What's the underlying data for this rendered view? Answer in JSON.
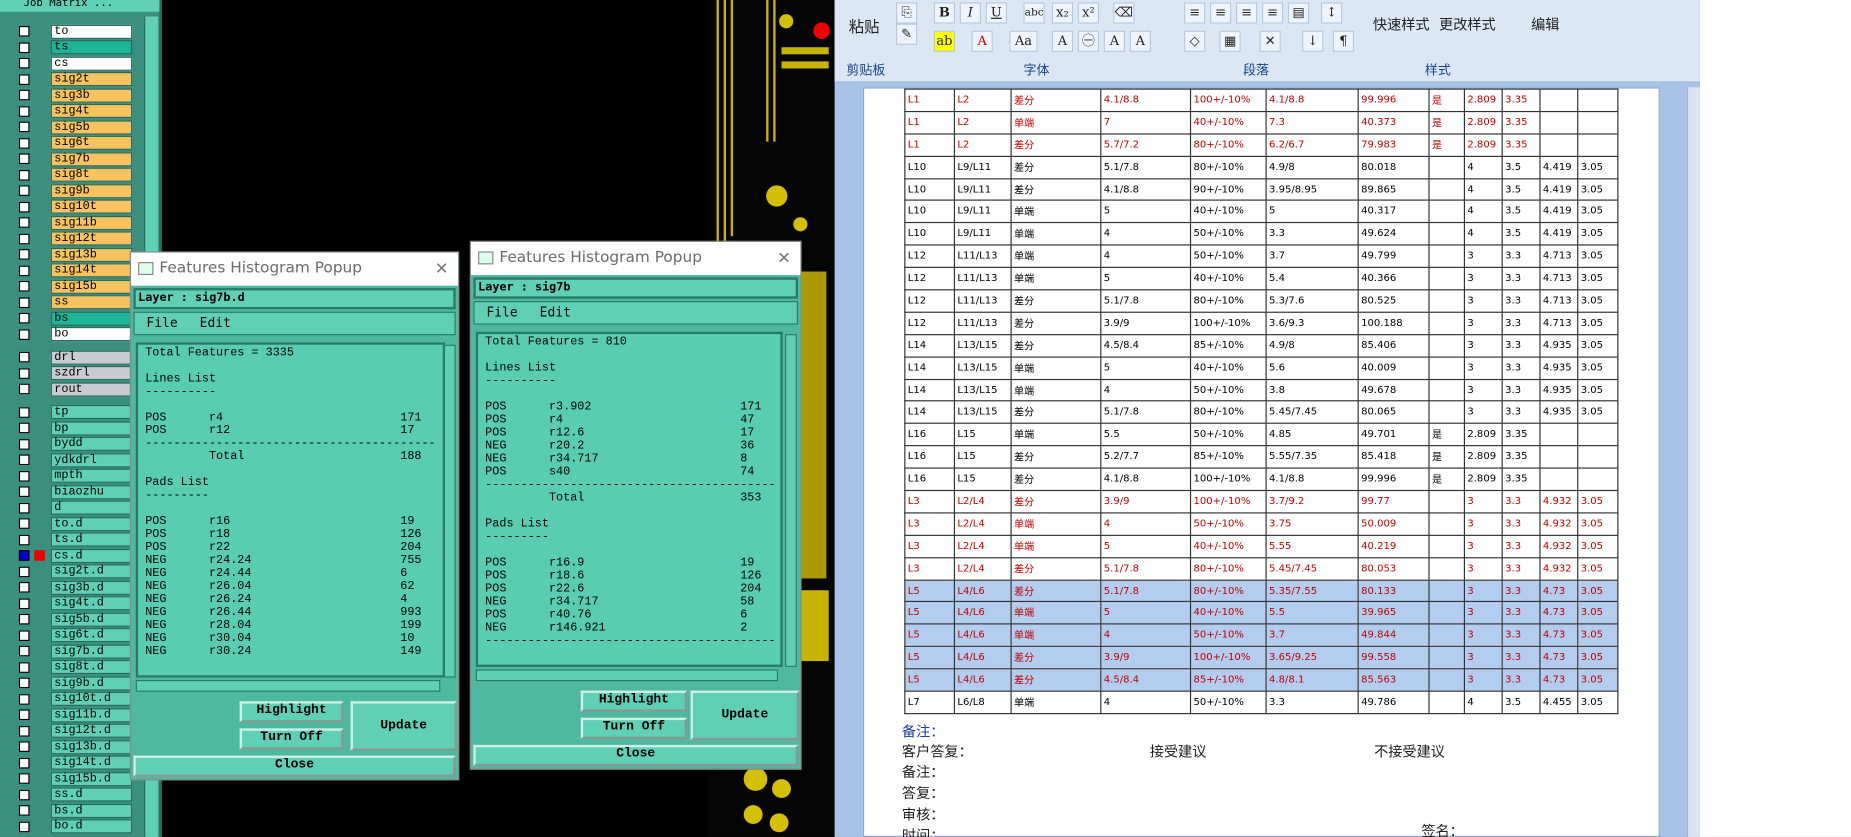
{
  "layer_panel": {
    "title": "Job Matrix ...",
    "rows": [
      {
        "name": "to",
        "style": "wht"
      },
      {
        "name": "ts",
        "style": "teal"
      },
      {
        "name": "cs",
        "style": "wht"
      },
      {
        "name": "sig2t",
        "style": "yel"
      },
      {
        "name": "sig3b",
        "style": "yel"
      },
      {
        "name": "sig4t",
        "style": "yel"
      },
      {
        "name": "sig5b",
        "style": "yel"
      },
      {
        "name": "sig6t",
        "style": "yel"
      },
      {
        "name": "sig7b",
        "style": "yel"
      },
      {
        "name": "sig8t",
        "style": "yel"
      },
      {
        "name": "sig9b",
        "style": "yel"
      },
      {
        "name": "sig10t",
        "style": "yel"
      },
      {
        "name": "sig11b",
        "style": "yel"
      },
      {
        "name": "sig12t",
        "style": "yel"
      },
      {
        "name": "sig13b",
        "style": "yel"
      },
      {
        "name": "sig14t",
        "style": "yel"
      },
      {
        "name": "sig15b",
        "style": "yel"
      },
      {
        "name": "ss",
        "style": "yel"
      },
      {
        "name": "bs",
        "style": "teal"
      },
      {
        "name": "bo",
        "style": "wht"
      },
      {
        "name": "drl",
        "style": "gry"
      },
      {
        "name": "szdrl",
        "style": "gry"
      },
      {
        "name": "rout",
        "style": "gry"
      },
      {
        "name": "tp",
        "style": ""
      },
      {
        "name": "bp",
        "style": ""
      },
      {
        "name": "bydd",
        "style": ""
      },
      {
        "name": "ydkdrl",
        "style": ""
      },
      {
        "name": "mpth",
        "style": ""
      },
      {
        "name": "biaozhu",
        "style": ""
      },
      {
        "name": "d",
        "style": ""
      },
      {
        "name": "to.d",
        "style": ""
      },
      {
        "name": "ts.d",
        "style": ""
      },
      {
        "name": "cs.d",
        "style": "",
        "active": true
      },
      {
        "name": "sig2t.d",
        "style": ""
      },
      {
        "name": "sig3b.d",
        "style": ""
      },
      {
        "name": "sig4t.d",
        "style": ""
      },
      {
        "name": "sig5b.d",
        "style": ""
      },
      {
        "name": "sig6t.d",
        "style": ""
      },
      {
        "name": "sig7b.d",
        "style": ""
      },
      {
        "name": "sig8t.d",
        "style": ""
      },
      {
        "name": "sig9b.d",
        "style": ""
      },
      {
        "name": "sig10t.d",
        "style": ""
      },
      {
        "name": "sig11b.d",
        "style": ""
      },
      {
        "name": "sig12t.d",
        "style": ""
      },
      {
        "name": "sig13b.d",
        "style": ""
      },
      {
        "name": "sig14t.d",
        "style": ""
      },
      {
        "name": "sig15b.d",
        "style": ""
      },
      {
        "name": "ss.d",
        "style": ""
      },
      {
        "name": "bs.d",
        "style": ""
      },
      {
        "name": "bo.d",
        "style": ""
      }
    ]
  },
  "popup1": {
    "title": "Features Histogram Popup",
    "layer": "Layer :  sig7b.d",
    "menu": [
      "File",
      "Edit"
    ],
    "text": "Total Features = 3335\n\nLines List\n----------\n\nPOS      r4                         171\nPOS      r12                        17\n-----------------------------------------\n         Total                      188\n\nPads List\n---------\n\nPOS      r16                        19\nPOS      r18                        126\nPOS      r22                        204\nNEG      r24.24                     755\nNEG      r24.44                     6\nNEG      r26.04                     62\nNEG      r26.24                     4\nNEG      r26.44                     993\nNEG      r28.04                     199\nNEG      r30.04                     10\nNEG      r30.24                     149",
    "buttons": {
      "highlight": "Highlight",
      "turnoff": "Turn Off",
      "update": "Update",
      "close": "Close"
    }
  },
  "popup2": {
    "title": "Features Histogram Popup",
    "layer": "Layer :  sig7b",
    "menu": [
      "File",
      "Edit"
    ],
    "text": "Total Features = 810\n\nLines List\n----------\n\nPOS      r3.902                     171\nPOS      r4                         47\nPOS      r12.6                      17\nNEG      r20.2                      36\nNEG      r34.717                    8\nPOS      s40                        74\n-----------------------------------------\n         Total                      353\n\nPads List\n---------\n\nPOS      r16.9                      19\nPOS      r18.6                      126\nPOS      r22.6                      204\nNEG      r34.717                    58\nPOS      r40.76                     6\nNEG      r146.921                   2\n-----------------------------------------",
    "buttons": {
      "highlight": "Highlight",
      "turnoff": "Turn Off",
      "update": "Update",
      "close": "Close"
    }
  },
  "ribbon": {
    "paste": "粘贴",
    "clipboard": "剪贴板",
    "font": "字体",
    "paragraph": "段落",
    "styles": "样式",
    "quick_styles": "快速样式",
    "change_styles": "更改样式",
    "edit": "编辑",
    "font_buttons": [
      "B",
      "I",
      "U",
      "abc",
      "x₂",
      "x²",
      "A",
      "Aa",
      "A",
      "A",
      "A"
    ]
  },
  "table_rows": [
    {
      "cls": "red",
      "c": [
        "L1",
        "L2",
        "差分",
        "4.1/8.8",
        "100+/-10%",
        "4.1/8.8",
        "99.996",
        "是",
        "2.809",
        "3.35",
        "",
        ""
      ]
    },
    {
      "cls": "red",
      "c": [
        "L1",
        "L2",
        "单端",
        "7",
        "40+/-10%",
        "7.3",
        "40.373",
        "是",
        "2.809",
        "3.35",
        "",
        ""
      ]
    },
    {
      "cls": "red",
      "c": [
        "L1",
        "L2",
        "差分",
        "5.7/7.2",
        "80+/-10%",
        "6.2/6.7",
        "79.983",
        "是",
        "2.809",
        "3.35",
        "",
        ""
      ]
    },
    {
      "cls": "",
      "c": [
        "L10",
        "L9/L11",
        "差分",
        "5.1/7.8",
        "80+/-10%",
        "4.9/8",
        "80.018",
        "",
        "4",
        "3.5",
        "4.419",
        "3.05"
      ]
    },
    {
      "cls": "",
      "c": [
        "L10",
        "L9/L11",
        "差分",
        "4.1/8.8",
        "90+/-10%",
        "3.95/8.95",
        "89.865",
        "",
        "4",
        "3.5",
        "4.419",
        "3.05"
      ]
    },
    {
      "cls": "",
      "c": [
        "L10",
        "L9/L11",
        "单端",
        "5",
        "40+/-10%",
        "5",
        "40.317",
        "",
        "4",
        "3.5",
        "4.419",
        "3.05"
      ]
    },
    {
      "cls": "",
      "c": [
        "L10",
        "L9/L11",
        "单端",
        "4",
        "50+/-10%",
        "3.3",
        "49.624",
        "",
        "4",
        "3.5",
        "4.419",
        "3.05"
      ]
    },
    {
      "cls": "",
      "c": [
        "L12",
        "L11/L13",
        "单端",
        "4",
        "50+/-10%",
        "3.7",
        "49.799",
        "",
        "3",
        "3.3",
        "4.713",
        "3.05"
      ]
    },
    {
      "cls": "",
      "c": [
        "L12",
        "L11/L13",
        "单端",
        "5",
        "40+/-10%",
        "5.4",
        "40.366",
        "",
        "3",
        "3.3",
        "4.713",
        "3.05"
      ]
    },
    {
      "cls": "",
      "c": [
        "L12",
        "L11/L13",
        "差分",
        "5.1/7.8",
        "80+/-10%",
        "5.3/7.6",
        "80.525",
        "",
        "3",
        "3.3",
        "4.713",
        "3.05"
      ]
    },
    {
      "cls": "",
      "c": [
        "L12",
        "L11/L13",
        "差分",
        "3.9/9",
        "100+/-10%",
        "3.6/9.3",
        "100.188",
        "",
        "3",
        "3.3",
        "4.713",
        "3.05"
      ]
    },
    {
      "cls": "",
      "c": [
        "L14",
        "L13/L15",
        "差分",
        "4.5/8.4",
        "85+/-10%",
        "4.9/8",
        "85.406",
        "",
        "3",
        "3.3",
        "4.935",
        "3.05"
      ]
    },
    {
      "cls": "",
      "c": [
        "L14",
        "L13/L15",
        "单端",
        "5",
        "40+/-10%",
        "5.6",
        "40.009",
        "",
        "3",
        "3.3",
        "4.935",
        "3.05"
      ]
    },
    {
      "cls": "",
      "c": [
        "L14",
        "L13/L15",
        "单端",
        "4",
        "50+/-10%",
        "3.8",
        "49.678",
        "",
        "3",
        "3.3",
        "4.935",
        "3.05"
      ]
    },
    {
      "cls": "",
      "c": [
        "L14",
        "L13/L15",
        "差分",
        "5.1/7.8",
        "80+/-10%",
        "5.45/7.45",
        "80.065",
        "",
        "3",
        "3.3",
        "4.935",
        "3.05"
      ]
    },
    {
      "cls": "",
      "c": [
        "L16",
        "L15",
        "单端",
        "5.5",
        "50+/-10%",
        "4.85",
        "49.701",
        "是",
        "2.809",
        "3.35",
        "",
        ""
      ]
    },
    {
      "cls": "",
      "c": [
        "L16",
        "L15",
        "差分",
        "5.2/7.7",
        "85+/-10%",
        "5.55/7.35",
        "85.418",
        "是",
        "2.809",
        "3.35",
        "",
        ""
      ]
    },
    {
      "cls": "",
      "c": [
        "L16",
        "L15",
        "差分",
        "4.1/8.8",
        "100+/-10%",
        "4.1/8.8",
        "99.996",
        "是",
        "2.809",
        "3.35",
        "",
        ""
      ]
    },
    {
      "cls": "red",
      "c": [
        "L3",
        "L2/L4",
        "差分",
        "3.9/9",
        "100+/-10%",
        "3.7/9.2",
        "99.77",
        "",
        "3",
        "3.3",
        "4.932",
        "3.05"
      ]
    },
    {
      "cls": "red",
      "c": [
        "L3",
        "L2/L4",
        "单端",
        "4",
        "50+/-10%",
        "3.75",
        "50.009",
        "",
        "3",
        "3.3",
        "4.932",
        "3.05"
      ]
    },
    {
      "cls": "red",
      "c": [
        "L3",
        "L2/L4",
        "单端",
        "5",
        "40+/-10%",
        "5.55",
        "40.219",
        "",
        "3",
        "3.3",
        "4.932",
        "3.05"
      ]
    },
    {
      "cls": "red",
      "c": [
        "L3",
        "L2/L4",
        "差分",
        "5.1/7.8",
        "80+/-10%",
        "5.45/7.45",
        "80.053",
        "",
        "3",
        "3.3",
        "4.932",
        "3.05"
      ]
    },
    {
      "cls": "sel",
      "c": [
        "L5",
        "L4/L6",
        "差分",
        "5.1/7.8",
        "80+/-10%",
        "5.35/7.55",
        "80.133",
        "",
        "3",
        "3.3",
        "4.73",
        "3.05"
      ]
    },
    {
      "cls": "sel",
      "c": [
        "L5",
        "L4/L6",
        "单端",
        "5",
        "40+/-10%",
        "5.5",
        "39.965",
        "",
        "3",
        "3.3",
        "4.73",
        "3.05"
      ]
    },
    {
      "cls": "sel",
      "c": [
        "L5",
        "L4/L6",
        "单端",
        "4",
        "50+/-10%",
        "3.7",
        "49.844",
        "",
        "3",
        "3.3",
        "4.73",
        "3.05"
      ]
    },
    {
      "cls": "sel",
      "c": [
        "L5",
        "L4/L6",
        "差分",
        "3.9/9",
        "100+/-10%",
        "3.65/9.25",
        "99.558",
        "",
        "3",
        "3.3",
        "4.73",
        "3.05"
      ]
    },
    {
      "cls": "sel",
      "c": [
        "L5",
        "L4/L6",
        "差分",
        "4.5/8.4",
        "85+/-10%",
        "4.8/8.1",
        "85.563",
        "",
        "3",
        "3.3",
        "4.73",
        "3.05"
      ]
    },
    {
      "cls": "",
      "c": [
        "L7",
        "L6/L8",
        "单端",
        "4",
        "50+/-10%",
        "3.3",
        "49.786",
        "",
        "4",
        "3.5",
        "4.455",
        "3.05"
      ]
    }
  ],
  "notes": {
    "remark1": "备注：",
    "customer": "客户答复：",
    "accept": "接受建议",
    "reject": "不接受建议",
    "remark2": "备注：",
    "reply": "答复：",
    "review": "审核：",
    "time": "时间：",
    "sign": "签名："
  }
}
